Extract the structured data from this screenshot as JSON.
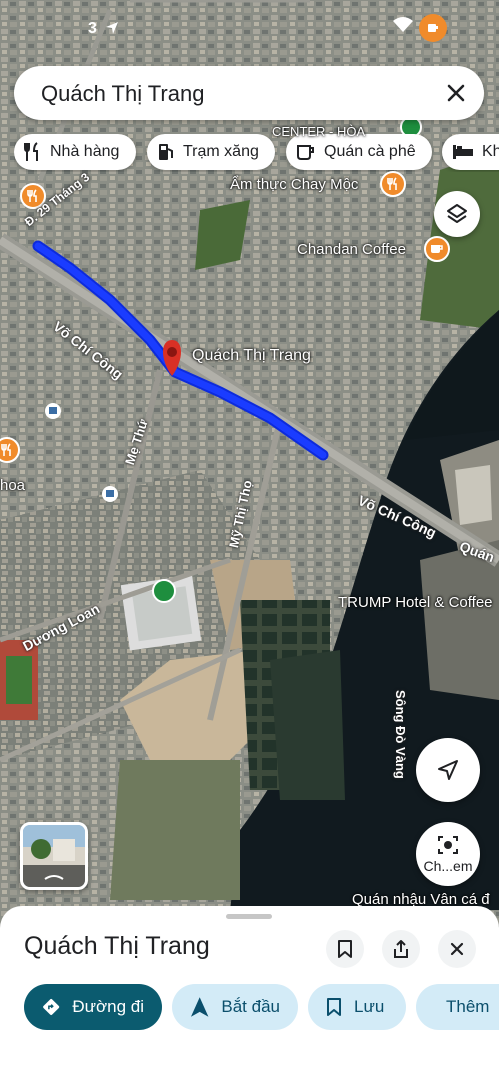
{
  "status": {
    "time": "3"
  },
  "search": {
    "query": "Quách Thị Trang"
  },
  "chips": [
    {
      "label": "Nhà hàng",
      "icon": "fork-knife-icon"
    },
    {
      "label": "Trạm xăng",
      "icon": "gas-station-icon"
    },
    {
      "label": "Quán cà phê",
      "icon": "coffee-cup-icon"
    },
    {
      "label": "Kh",
      "icon": "bed-icon"
    }
  ],
  "map": {
    "pin_label": "Quách Thị Trang",
    "pois": {
      "poi1": "Ẩm thực Chay Mộc",
      "poi2": "Chandan Coffee",
      "poi3": "TRUMP Hotel & Coffee",
      "poi4": "Quán nhậu Vân cá đ",
      "poi5": "hoa"
    },
    "roads": {
      "road1": "Đ. 29 Tháng 3",
      "road2": "Võ Chí Công",
      "road3": "Võ Chí Công",
      "road4": "Mẹ Thứ",
      "road5": "Mỹ Thị Thọ",
      "road6": "Dương Loan",
      "road7": "Sông Đò Vàng",
      "road8": "Quán",
      "road9": "CENTER - HÒA"
    },
    "highlight_color": "#1a3cff"
  },
  "camera_button": {
    "label": "Ch...em"
  },
  "sheet": {
    "title": "Quách Thị Trang",
    "actions": {
      "directions": "Đường đi",
      "start": "Bắt đầu",
      "save": "Lưu",
      "more": "Thêm"
    }
  }
}
